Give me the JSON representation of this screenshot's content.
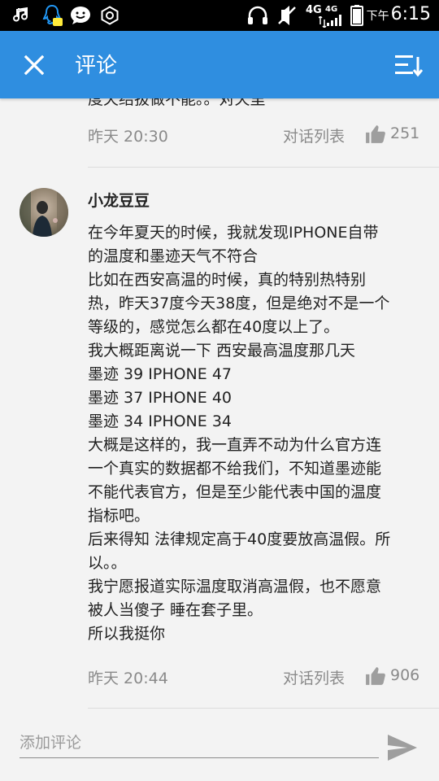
{
  "status_bar": {
    "network_1": "4G",
    "network_2": "4G",
    "ampm": "下午",
    "time": "6:15"
  },
  "header": {
    "title": "评论"
  },
  "prev_comment": {
    "partial_text": "度天结拔做不能。。对天里",
    "time": "昨天 20:30",
    "conversation_label": "对话列表",
    "likes": "251"
  },
  "comment": {
    "username": "小龙豆豆",
    "lines": [
      "在今年夏天的时候，我就发现IPHONE自带",
      "的温度和墨迹天气不符合",
      "比如在西安高温的时候，真的特别热特别",
      "热，昨天37度今天38度，但是绝对不是一个",
      "等级的，感觉怎么都在40度以上了。",
      "我大概距离说一下 西安最高温度那几天",
      "墨迹 39 IPHONE 47",
      "墨迹 37 IPHONE 40",
      "墨迹 34 IPHONE 34",
      "大概是这样的，我一直弄不动为什么官方连",
      "一个真实的数据都不给我们，不知道墨迹能",
      "不能代表官方，但是至少能代表中国的温度",
      "指标吧。",
      "后来得知 法律规定高于40度要放高温假。所",
      "以。。",
      "我宁愿报道实际温度取消高温假，也不愿意",
      "被人当傻子 睡在套子里。",
      "所以我挺你"
    ],
    "time": "昨天 20:44",
    "conversation_label": "对话列表",
    "likes": "906"
  },
  "input": {
    "placeholder": "添加评论"
  },
  "colors": {
    "appbar": "#2f8ee0",
    "meta_text": "#8a8a8a",
    "background": "#f3f3f3"
  }
}
